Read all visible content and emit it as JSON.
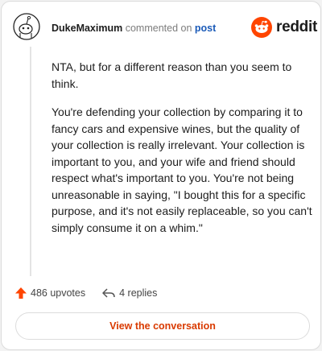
{
  "comment": {
    "author": "DukeMaximum",
    "action_text": "commented on",
    "link_text": "post",
    "paragraphs": [
      "NTA, but for a different reason than you seem to think.",
      "You're defending your collection by comparing it to fancy cars and expensive wines, but the quality of your collection is really irrelevant. Your collection is important to you, and your wife and friend should respect what's important to you. You're not being unreasonable in saying, \"I bought this for a specific purpose, and it's not easily replaceable, so you can't simply consume it on a whim.\""
    ],
    "upvotes_label": "486 upvotes",
    "replies_label": "4 replies",
    "view_button_label": "View the conversation"
  },
  "brand": {
    "name": "reddit",
    "color": "#ff4500"
  },
  "icons": {
    "avatar": "snoo-avatar-icon",
    "upvote": "upvote-arrow-icon",
    "reply": "reply-arrow-icon",
    "logo": "reddit-logo-icon"
  },
  "colors": {
    "accent": "#d93a00",
    "link": "#1a5ab8",
    "upvote": "#ff4500"
  }
}
